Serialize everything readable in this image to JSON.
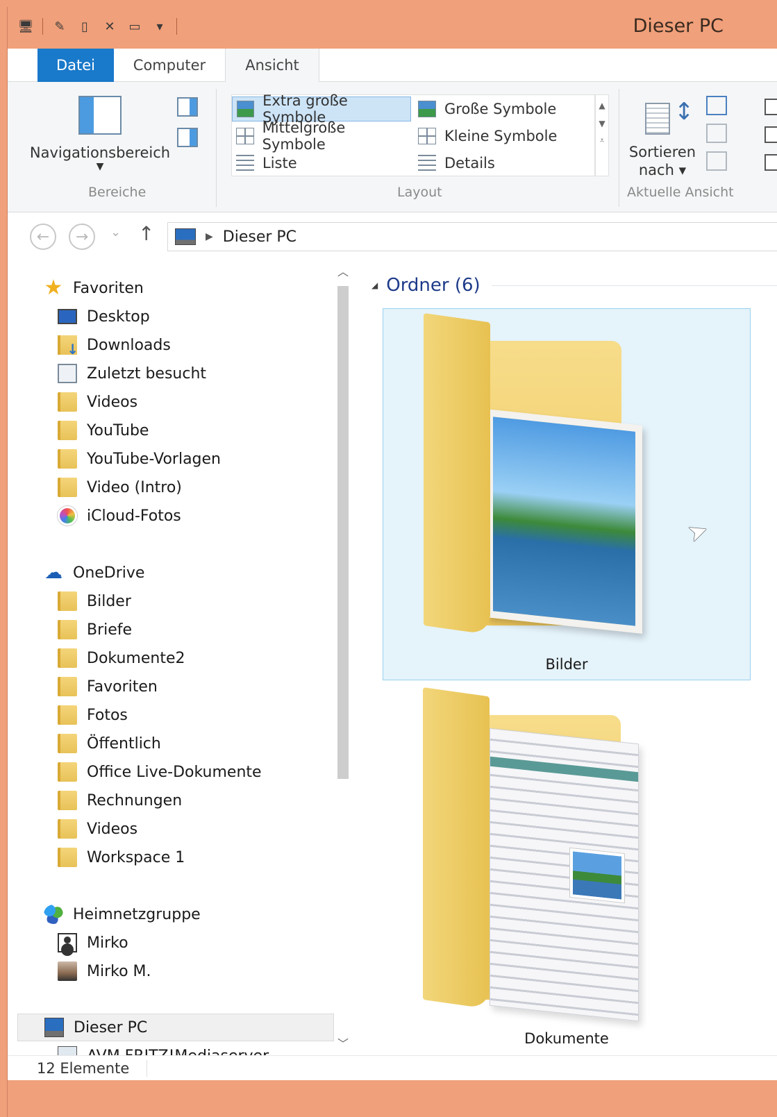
{
  "window": {
    "title": "Dieser PC",
    "accent": "#f0a07a"
  },
  "quick_access": [
    "computer-icon",
    "properties-icon",
    "new-folder-icon",
    "delete-icon",
    "rename-icon",
    "customize-dropdown-icon"
  ],
  "ribbon": {
    "tabs": {
      "file": "Datei",
      "computer": "Computer",
      "view": "Ansicht"
    },
    "panes": {
      "nav_label": "Navigationsbereich",
      "group_label": "Bereiche"
    },
    "layout": {
      "group_label": "Layout",
      "items": {
        "extra_large": "Extra große Symbole",
        "large": "Große Symbole",
        "medium": "Mittelgroße Symbole",
        "small": "Kleine Symbole",
        "list": "Liste",
        "details": "Details"
      },
      "selected": "Extra große Symbole"
    },
    "current_view": {
      "sort_line1": "Sortieren",
      "sort_line2": "nach",
      "group_label": "Aktuelle Ansicht"
    }
  },
  "address": {
    "path": "Dieser PC"
  },
  "nav_pane": {
    "favorites": {
      "label": "Favoriten",
      "items": [
        "Desktop",
        "Downloads",
        "Zuletzt besucht",
        "Videos",
        "YouTube",
        "YouTube-Vorlagen",
        "Video (Intro)",
        "iCloud-Fotos"
      ]
    },
    "onedrive": {
      "label": "OneDrive",
      "items": [
        "Bilder",
        "Briefe",
        "Dokumente2",
        "Favoriten",
        "Fotos",
        "Öffentlich",
        "Office Live-Dokumente",
        "Rechnungen",
        "Videos",
        "Workspace 1"
      ]
    },
    "homegroup": {
      "label": "Heimnetzgruppe",
      "items": [
        "Mirko",
        "Mirko M."
      ]
    },
    "this_pc": {
      "label": "Dieser PC",
      "items": [
        "AVM FRITZ!Mediaserver"
      ]
    }
  },
  "content": {
    "group_title": "Ordner (6)",
    "tiles": [
      "Bilder",
      "Dokumente"
    ],
    "selected": "Bilder"
  },
  "status": {
    "count": "12 Elemente"
  }
}
